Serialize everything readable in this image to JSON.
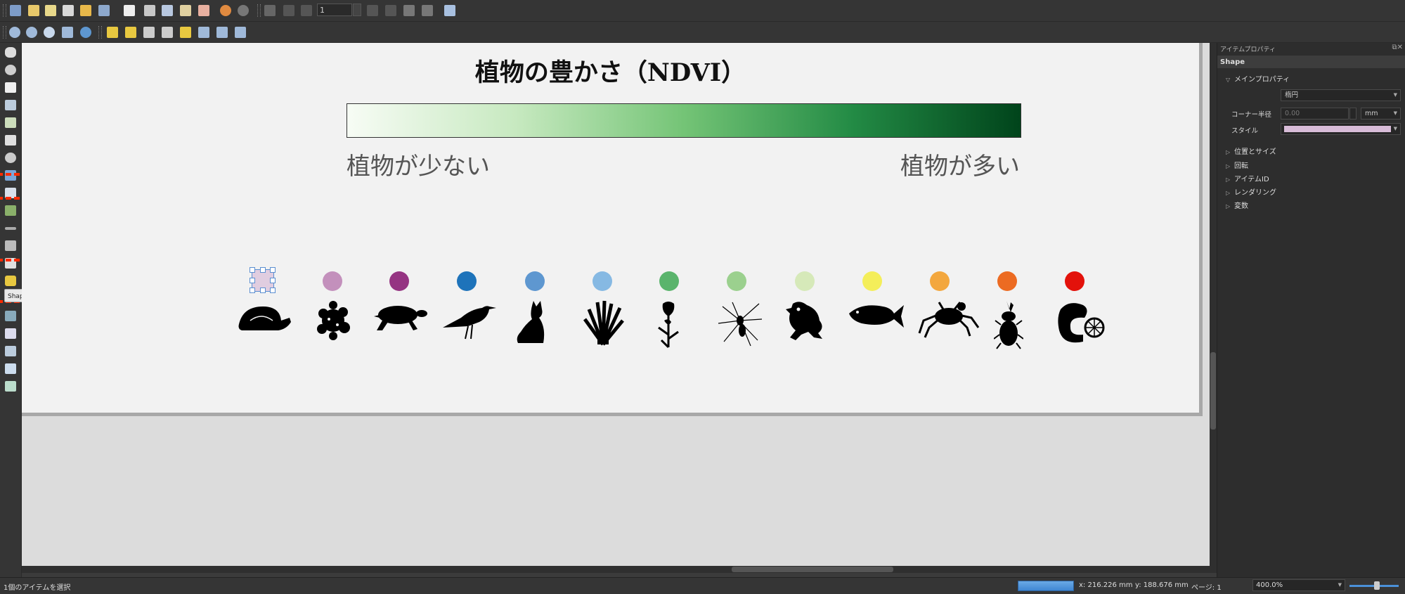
{
  "toolbar": {
    "page_number": "1",
    "icons": [
      "save-icon",
      "new-layout-icon",
      "duplicate-layout-icon",
      "layout-manager-icon",
      "open-template-icon",
      "save-template-icon",
      "page-setup-icon",
      "print-icon",
      "export-image-icon",
      "export-svg-icon",
      "export-pdf-icon",
      "undo-icon",
      "redo-icon",
      "atlas-icon",
      "first-feature-icon",
      "previous-feature-icon",
      "next-feature-icon",
      "last-feature-icon",
      "print-atlas-icon",
      "export-atlas-icon",
      "atlas-settings-icon"
    ]
  },
  "tool_tooltip": "Shapeを追加",
  "layout": {
    "title": "植物の豊かさ（NDVI）",
    "legend_low": "植物が少ない",
    "legend_high": "植物が多い",
    "gradient_colors": [
      "#f7fcf5",
      "#c7e9c0",
      "#74c476",
      "#238b45",
      "#00441b"
    ],
    "dot_colors": [
      "#e0cde0",
      "#c390bc",
      "#953482",
      "#1e73ba",
      "#5e97d0",
      "#86b9e3",
      "#5ab46c",
      "#9bd08e",
      "#d6e9b9",
      "#f4ee5a",
      "#f3a73e",
      "#ec6b22",
      "#e3120b"
    ],
    "silhouettes": [
      "snail-icon",
      "moss-icon",
      "turtle-icon",
      "bird-icon",
      "cat-icon",
      "grass-icon",
      "iris-icon",
      "spider-icon",
      "frog-icon",
      "fish-icon",
      "crab-icon",
      "beetle-icon",
      "mushroom-icon"
    ]
  },
  "panel": {
    "title": "アイテムプロパティ",
    "item_type": "Shape",
    "main_section": "メインプロパティ",
    "shape_value": "楕円",
    "corner_label": "コーナー半径",
    "corner_value": "0.00",
    "unit_value": "mm",
    "style_label": "スタイル",
    "style_color": "#d8bcd8",
    "sections": [
      "位置とサイズ",
      "回転",
      "アイテムID",
      "レンダリング",
      "変数"
    ]
  },
  "status": {
    "message": "1個のアイテムを選択",
    "x": "x: 216.226 mm",
    "y": "y: 188.676 mm",
    "page": "ページ: 1",
    "zoom": "400.0%"
  }
}
